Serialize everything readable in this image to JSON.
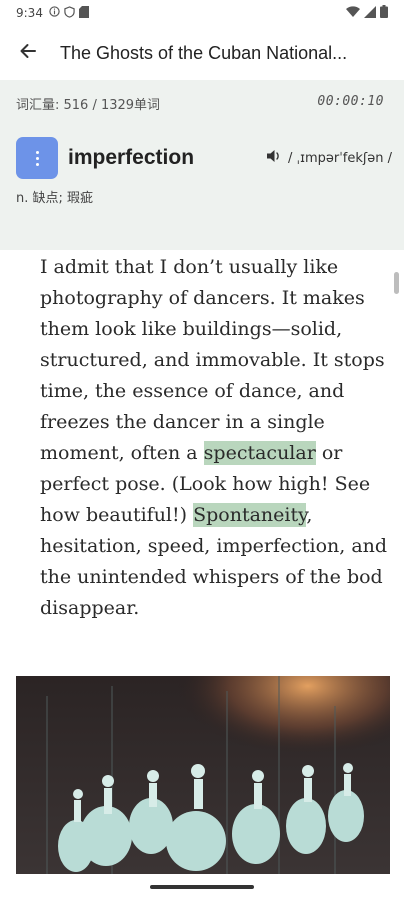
{
  "status_bar": {
    "time": "9:34",
    "icons": [
      "info-circle-icon",
      "shield-icon",
      "sd-card-icon"
    ],
    "right_icons": [
      "wifi-icon",
      "signal-icon",
      "battery-icon"
    ]
  },
  "app_bar": {
    "back_icon": "arrow-left-icon",
    "title": "The Ghosts of the Cuban National..."
  },
  "vocab": {
    "label": "词汇量: 516 / 1329单词",
    "timer": "00:00:10"
  },
  "word": {
    "headword": "imperfection",
    "pronunciation": "/ ˌɪmpərˈfekʃən /",
    "definition": "n. 缺点; 瑕疵"
  },
  "article": {
    "lines": [
      {
        "text": "I admit that I don’t usually like"
      },
      {
        "text": "photography of dancers. It makes"
      },
      {
        "text": "them look like buildings—solid,"
      },
      {
        "text": "structured, and immovable. It stops"
      },
      {
        "text": "time, the essence of dance, and"
      },
      {
        "text": "freezes the dancer in a single"
      },
      {
        "pre": "moment, often a ",
        "hl": "spectacular",
        "post": " or"
      },
      {
        "text": "perfect pose. (Look how high! See"
      },
      {
        "pre": "how beautiful!) ",
        "hl": "Spontaneity",
        "post": ","
      },
      {
        "text": "hesitation, speed, imperfection, and"
      },
      {
        "text": "the unintended whispers of the bod"
      },
      {
        "text": "disappear."
      }
    ]
  },
  "colors": {
    "panel_bg": "#eef2ef",
    "menu_button": "#6d93e8",
    "highlight": "#b9d6bd"
  }
}
